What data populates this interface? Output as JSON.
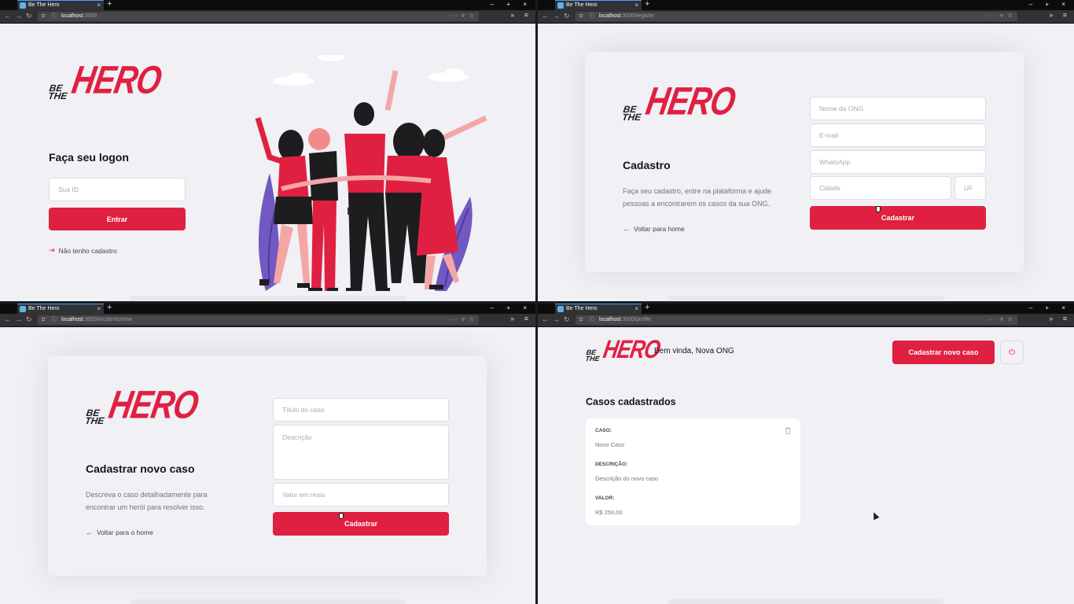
{
  "browser": {
    "tab_title": "Be The Hero",
    "new_tab": "+",
    "window_controls": "– + ×",
    "tab_close": "×"
  },
  "logo": {
    "be": "BE",
    "the": "THE",
    "hero": "HERO"
  },
  "login": {
    "url_host": "localhost",
    "url_path": ":3000",
    "title": "Faça seu logon",
    "id_placeholder": "Sua ID",
    "submit_label": "Entrar",
    "register_link": "Não tenho cadastro"
  },
  "register": {
    "url_host": "localhost",
    "url_path": ":3000/register",
    "title": "Cadastro",
    "description": "Faça seu cadastro, entre na plataforma e ajude pessoas a encontrarem os casos da sua ONG.",
    "back_link": "Voltar para home",
    "fields": {
      "name": "Nome da ONG",
      "email": "E-mail",
      "whatsapp": "WhatsApp",
      "city": "Cidade",
      "uf": "UF"
    },
    "submit_label": "Cadastrar"
  },
  "new_incident": {
    "url_host": "localhost",
    "url_path": ":3000/incidents/new",
    "title": "Cadastrar novo caso",
    "description": "Descreva o caso detalhadamente para encontrar um herói para resolver isso.",
    "back_link": "Voltar para o home",
    "fields": {
      "title": "Título do caso",
      "description": "Descrição",
      "value": "Valor em reais"
    },
    "submit_label": "Cadastrar"
  },
  "profile": {
    "url_host": "localhost",
    "url_path": ":3000/profile",
    "welcome": "Bem vinda, Nova ONG",
    "new_case_button": "Cadastrar novo caso",
    "section_title": "Casos cadastrados",
    "cases": [
      {
        "case_label": "CASO:",
        "case_value": "Novo Caso",
        "description_label": "DESCRIÇÃO:",
        "description_value": "Descrição do novo caso",
        "value_label": "VALOR:",
        "value_value": "R$ 250,00"
      }
    ]
  },
  "colors": {
    "accent": "#e02041",
    "background": "#f0f0f5",
    "text_dark": "#13131a",
    "text_muted": "#737380"
  },
  "icons": {
    "login_link": "log-in-icon",
    "back_link": "arrow-left-icon",
    "delete": "trash-icon",
    "logout": "power-icon"
  }
}
